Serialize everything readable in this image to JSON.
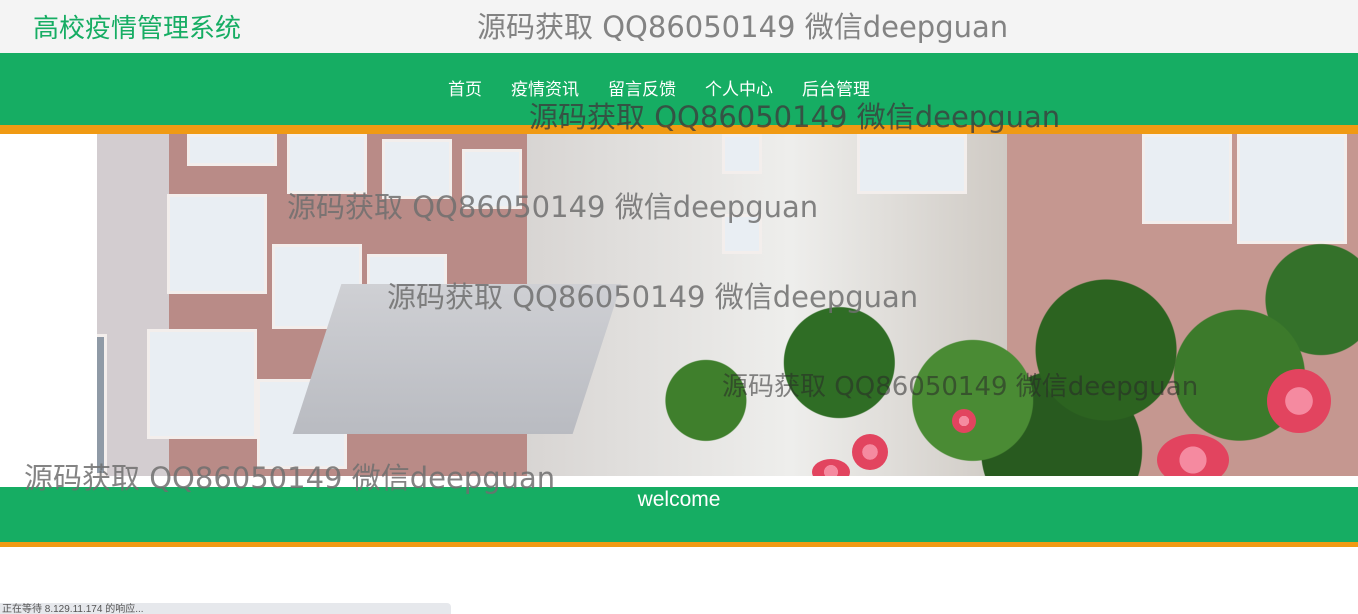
{
  "header": {
    "site_title": "高校疫情管理系统"
  },
  "nav": {
    "items": [
      {
        "label": "首页"
      },
      {
        "label": "疫情资讯"
      },
      {
        "label": "留言反馈"
      },
      {
        "label": "个人中心"
      },
      {
        "label": "后台管理"
      }
    ]
  },
  "banner": {
    "welcome": "welcome"
  },
  "watermark": {
    "text": "源码获取 QQ86050149 微信deepguan"
  },
  "status": {
    "text": "正在等待 8.129.11.174 的响应..."
  },
  "colors": {
    "brand_green": "#16ad63",
    "accent_orange": "#f09a13",
    "header_bg": "#f4f4f4"
  }
}
